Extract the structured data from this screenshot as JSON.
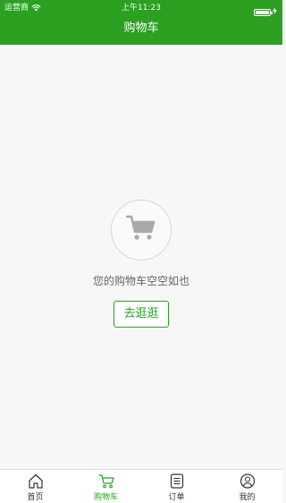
{
  "status_bar": {
    "carrier": "运营商",
    "time": "上午11:23",
    "wifi_icon": "wifi-icon",
    "battery_icon": "battery-icon",
    "charging_icon": "bolt-icon"
  },
  "header": {
    "title": "购物车"
  },
  "empty_state": {
    "icon": "shopping-cart-icon",
    "message": "您的购物车空空如也",
    "button_label": "去逛逛"
  },
  "tab_bar": {
    "active_color": "#2ba021",
    "items": [
      {
        "label": "首页",
        "icon": "home-icon",
        "active": false
      },
      {
        "label": "购物车",
        "icon": "cart-icon",
        "active": true
      },
      {
        "label": "订单",
        "icon": "order-list-icon",
        "active": false
      },
      {
        "label": "我的",
        "icon": "user-icon",
        "active": false
      }
    ]
  },
  "colors": {
    "brand": "#2ba021",
    "background": "#f7f7f7"
  }
}
